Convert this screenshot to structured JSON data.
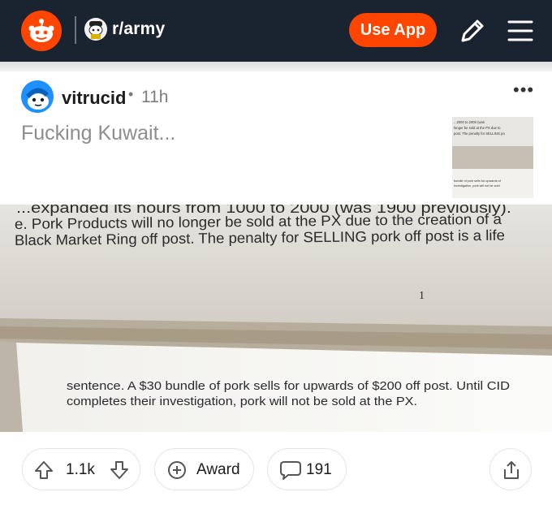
{
  "header": {
    "subreddit": "r/army",
    "use_app_label": "Use App",
    "colors": {
      "bar": "#1a2430",
      "accent": "#ff4500"
    },
    "icons": [
      "reddit-logo-icon",
      "army-subreddit-icon",
      "pencil-icon",
      "hamburger-menu-icon"
    ]
  },
  "post": {
    "author": "vitrucid",
    "separator": "•",
    "age": "11h",
    "title": "Fucking Kuwait...",
    "more_label": "•••"
  },
  "photo_text": {
    "top_line": "...expanded its hours from 1000 to 2000 (was 1900 previously).",
    "line1": "e. Pork Products will no longer be sold at the PX due to the creation of a",
    "line2": "Black Market Ring off post. The penalty for SELLING pork off post is a life",
    "page_number": "1",
    "line3": "sentence. A $30 bundle of pork sells for upwards of $200 off post. Until CID",
    "line4": "completes their investigation, pork will not be sold at the PX."
  },
  "thumb_text": {
    "l1": "...2000 to 2000 (was",
    "l2": "longer be sold at the PX due to",
    "l3": "post. The penalty for SELLING po",
    "l4": "bundle of pork sells for upwards of",
    "l5": "investigation, pork will not be sold"
  },
  "actions": {
    "vote_count": "1.1k",
    "award_label": "Award",
    "comment_count": "191"
  }
}
